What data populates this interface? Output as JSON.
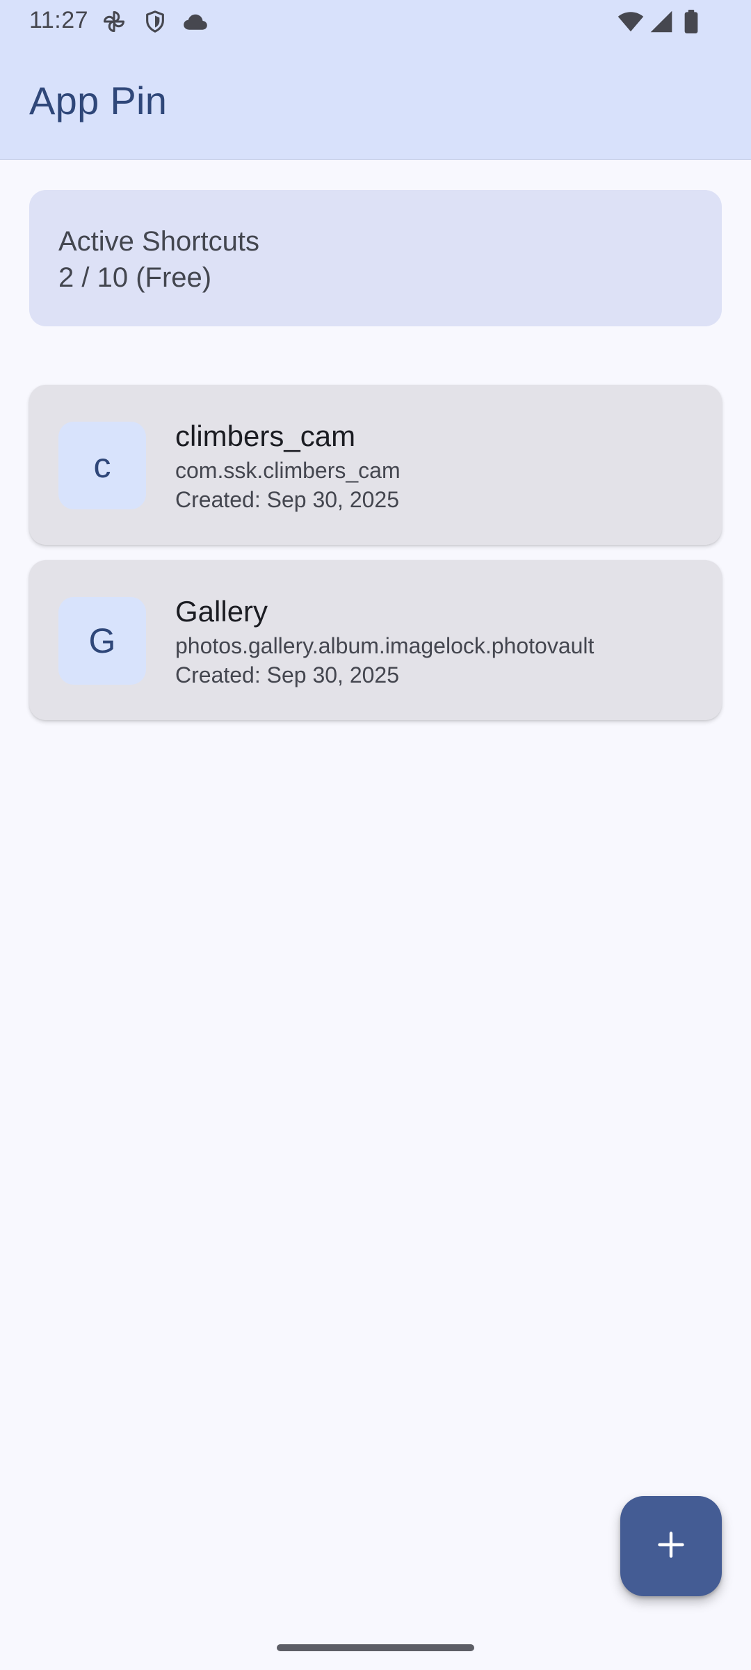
{
  "status_bar": {
    "time": "11:27",
    "left_icons": [
      "pinwheel-icon",
      "shield-icon",
      "cloud-icon"
    ],
    "right_icons": [
      "wifi-icon",
      "cellular-signal-icon",
      "battery-icon"
    ]
  },
  "app_bar": {
    "title": "App Pin"
  },
  "summary": {
    "label": "Active Shortcuts",
    "count_text": "2 / 10 (Free)"
  },
  "shortcuts": [
    {
      "initial": "c",
      "name": "climbers_cam",
      "package": "com.ssk.climbers_cam",
      "created": "Created: Sep 30, 2025"
    },
    {
      "initial": "G",
      "name": "Gallery",
      "package": "photos.gallery.album.imagelock.photovault",
      "created": "Created: Sep 30, 2025"
    }
  ],
  "fab": {
    "icon": "add-icon"
  },
  "colors": {
    "app_bar_bg": "#d8e1fb",
    "title": "#2f4779",
    "summary_card_bg": "#dde1f6",
    "list_card_bg": "#e3e2e8",
    "avatar_bg": "#d8e3fc",
    "fab_bg": "#445c94",
    "page_bg": "#f8f8fe"
  }
}
